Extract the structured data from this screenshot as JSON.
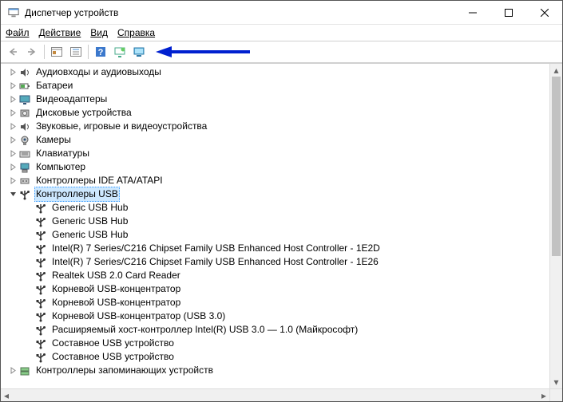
{
  "window": {
    "title": "Диспетчер устройств"
  },
  "menu": {
    "file": "Файл",
    "action": "Действие",
    "view": "Вид",
    "help": "Справка"
  },
  "tree": {
    "categories": [
      {
        "label": "Аудиовходы и аудиовыходы",
        "icon": "audio"
      },
      {
        "label": "Батареи",
        "icon": "battery"
      },
      {
        "label": "Видеоадаптеры",
        "icon": "display"
      },
      {
        "label": "Дисковые устройства",
        "icon": "disk"
      },
      {
        "label": "Звуковые, игровые и видеоустройства",
        "icon": "audio"
      },
      {
        "label": "Камеры",
        "icon": "camera"
      },
      {
        "label": "Клавиатуры",
        "icon": "keyboard"
      },
      {
        "label": "Компьютер",
        "icon": "computer"
      },
      {
        "label": "Контроллеры IDE ATA/ATAPI",
        "icon": "ide"
      },
      {
        "label": "Контроллеры USB",
        "icon": "usb",
        "expanded": true,
        "selected": true
      },
      {
        "label": "Контроллеры запоминающих устройств",
        "icon": "storage"
      }
    ],
    "usb_children": [
      "Generic USB Hub",
      "Generic USB Hub",
      "Generic USB Hub",
      "Intel(R) 7 Series/C216 Chipset Family USB Enhanced Host Controller - 1E2D",
      "Intel(R) 7 Series/C216 Chipset Family USB Enhanced Host Controller - 1E26",
      "Realtek USB 2.0 Card Reader",
      "Корневой USB-концентратор",
      "Корневой USB-концентратор",
      "Корневой USB-концентратор (USB 3.0)",
      "Расширяемый хост-контроллер Intel(R) USB 3.0 — 1.0 (Майкрософт)",
      "Составное USB устройство",
      "Составное USB устройство"
    ]
  }
}
